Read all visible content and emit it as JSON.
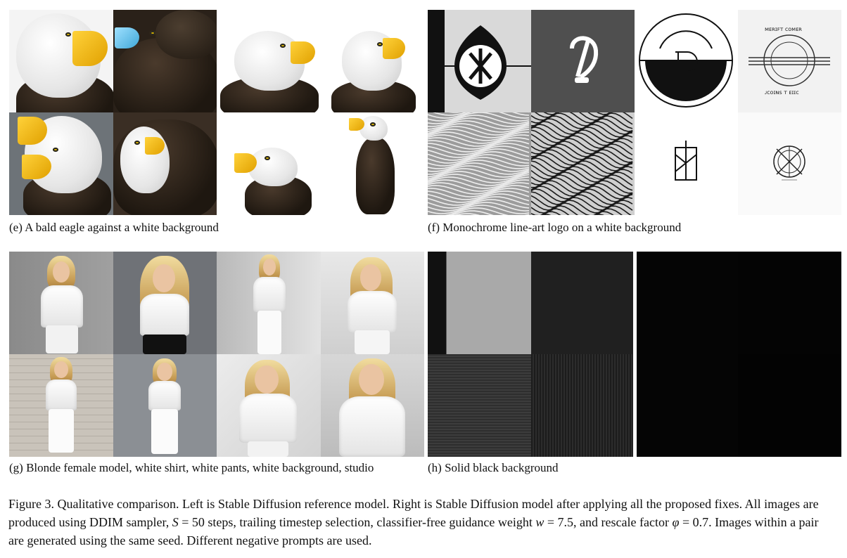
{
  "panels": {
    "e": {
      "label": "(e) A bald eagle against a white background"
    },
    "f": {
      "label": "(f) Monochrome line-art logo on a white background"
    },
    "g": {
      "label": "(g) Blonde female model, white shirt, white pants, white background, studio"
    },
    "h": {
      "label": "(h) Solid black background"
    }
  },
  "logo_text": {
    "arc_top": "ᴍᴇʀɪꜰᴛ ᴄᴏᴍᴇʀ",
    "arc_bottom": "ᴊᴄᴏɪɴs ᴛ ᴇɪɪᴄ"
  },
  "caption": {
    "part1": "Figure 3. Qualitative comparison. Left is Stable Diffusion reference model. Right is Stable Diffusion model after applying all the proposed fixes. All images are produced using DDIM sampler, ",
    "S": "S",
    "eq1": " = 50 steps, trailing timestep selection, classifier-free guidance weight ",
    "w": "w",
    "eq2": " = 7.5, and rescale factor ",
    "phi": "φ",
    "eq3": " = 0.7. Images within a pair are generated using the same seed. Different negative prompts are used."
  },
  "colors": {
    "eagle_beak": "#f2c01e",
    "eagle_body": "#2a2119",
    "hair": "#d8b775",
    "shirt": "#ffffff",
    "solid_black": "#050505"
  }
}
